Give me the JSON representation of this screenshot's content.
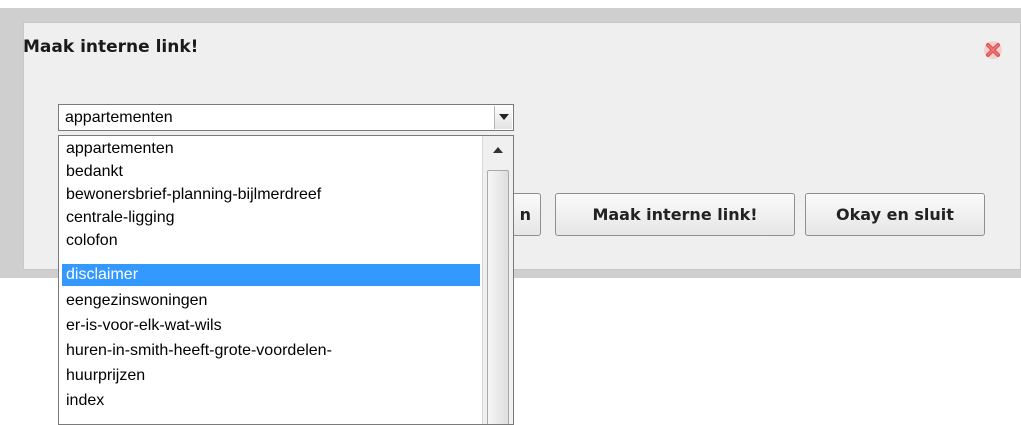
{
  "dialog": {
    "title": "Maak interne link!",
    "close_icon": "close-x-icon"
  },
  "select": {
    "value": "appartementen",
    "arrow_icon": "chevron-down-icon"
  },
  "buttons": {
    "partial_label": "n",
    "make_link_label": "Maak interne link!",
    "okay_close_label": "Okay en sluit"
  },
  "dropdown": {
    "options": [
      "appartementen",
      "bedankt",
      "bewonersbrief-planning-bijlmerdreef",
      "centrale-ligging",
      "colofon",
      "disclaimer",
      "eengezinswoningen",
      "er-is-voor-elk-wat-wils",
      "huren-in-smith-heeft-grote-voordelen-",
      "huurprijzen",
      "index"
    ],
    "selected": "disclaimer"
  },
  "colors": {
    "selection": "#3399ff",
    "dialog_bg": "#efefef",
    "backdrop": "#cfcfcf",
    "close_icon": "#d9534f"
  }
}
